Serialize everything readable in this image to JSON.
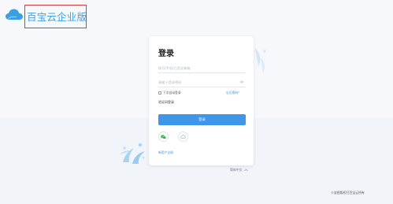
{
  "brand": {
    "name": "百宝云企业版"
  },
  "login": {
    "title": "登录",
    "account_placeholder": "帐号/手机/已验证邮箱",
    "password_placeholder": "请输入登录密码",
    "remember_label": "下次自动登录",
    "forgot_link": "忘记密码？",
    "sms_login_label": "验证码登录",
    "submit_label": "登录",
    "register_link": "新用户注册"
  },
  "footer": {
    "language": "简体中文",
    "copyright": "©该图版权归百宝云所有"
  },
  "colors": {
    "brand_blue": "#3aa0e6",
    "primary_button": "#3f95e8",
    "wechat_green": "#2bb44a",
    "highlight_red": "#d93a3a"
  },
  "icons": {
    "logo": "cloud-logo-icon",
    "wechat": "wechat-icon",
    "alt_login": "cloud-outline-icon",
    "password_toggle": "eye-icon",
    "language_caret": "chevron-up-icon"
  }
}
